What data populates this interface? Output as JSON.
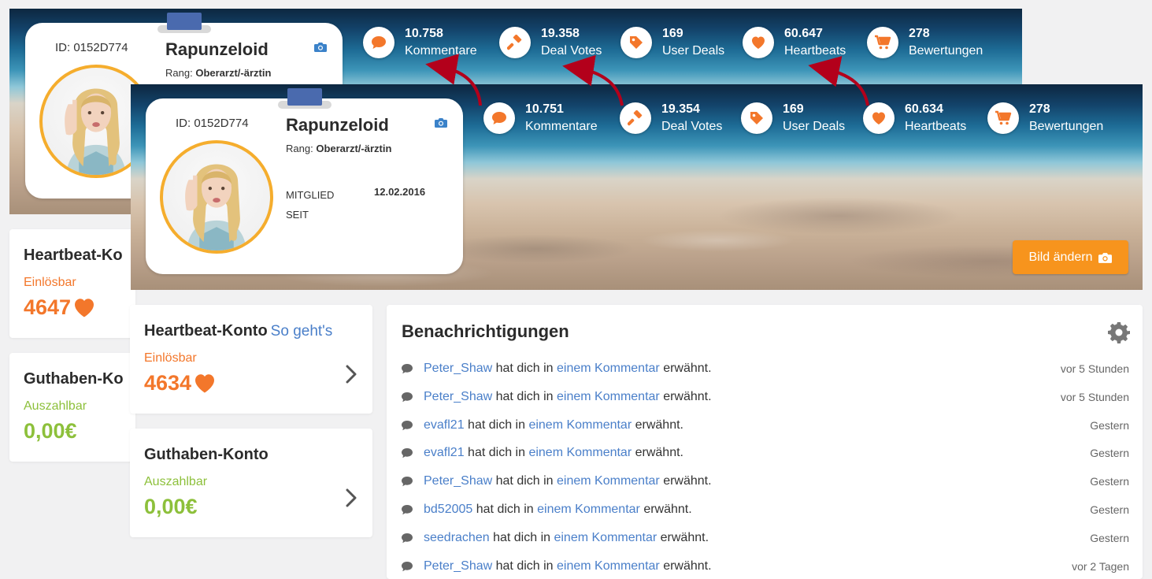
{
  "before": {
    "profile": {
      "id": "ID: 0152D774",
      "name": "Rapunzeloid",
      "rank_label": "Rang:",
      "rank_value": "Oberarzt/-ärztin"
    },
    "stats": [
      {
        "icon": "comment-icon",
        "value": "10.758",
        "label": "Kommentare"
      },
      {
        "icon": "hammer-icon",
        "value": "19.358",
        "label": "Deal Votes"
      },
      {
        "icon": "tag-icon",
        "value": "169",
        "label": "User Deals"
      },
      {
        "icon": "heart-icon",
        "value": "60.647",
        "label": "Heartbeats"
      },
      {
        "icon": "cart-icon",
        "value": "278",
        "label": "Bewertungen"
      }
    ],
    "heartbeat": {
      "title": "Heartbeat-Ko",
      "sub": "Einlösbar",
      "value": "4647"
    },
    "guthaben": {
      "title": "Guthaben-Ko",
      "sub": "Auszahlbar",
      "value": "0,00€"
    }
  },
  "after": {
    "profile": {
      "id": "ID: 0152D774",
      "name": "Rapunzeloid",
      "rank_label": "Rang:",
      "rank_value": "Oberarzt/-ärztin",
      "member_label_1": "MITGLIED",
      "member_label_2": "SEIT",
      "member_date": "12.02.2016"
    },
    "stats": [
      {
        "icon": "comment-icon",
        "value": "10.751",
        "label": "Kommentare"
      },
      {
        "icon": "hammer-icon",
        "value": "19.354",
        "label": "Deal Votes"
      },
      {
        "icon": "tag-icon",
        "value": "169",
        "label": "User Deals"
      },
      {
        "icon": "heart-icon",
        "value": "60.634",
        "label": "Heartbeats"
      },
      {
        "icon": "cart-icon",
        "value": "278",
        "label": "Bewertungen"
      }
    ],
    "change_image_label": "Bild ändern",
    "heartbeat": {
      "title": "Heartbeat-Konto",
      "link": "So geht's",
      "sub": "Einlösbar",
      "value": "4634"
    },
    "guthaben": {
      "title": "Guthaben-Konto",
      "sub": "Auszahlbar",
      "value": "0,00€"
    },
    "notifications": {
      "title": "Benachrichtigungen",
      "items": [
        {
          "user": "Peter_Shaw",
          "mid": "hat dich in",
          "link": "einem Kommentar",
          "end": "erwähnt.",
          "time": "vor 5 Stunden"
        },
        {
          "user": "Peter_Shaw",
          "mid": "hat dich in",
          "link": "einem Kommentar",
          "end": "erwähnt.",
          "time": "vor 5 Stunden"
        },
        {
          "user": "evafl21",
          "mid": "hat dich in",
          "link": "einem Kommentar",
          "end": "erwähnt.",
          "time": "Gestern"
        },
        {
          "user": "evafl21",
          "mid": "hat dich in",
          "link": "einem Kommentar",
          "end": "erwähnt.",
          "time": "Gestern"
        },
        {
          "user": "Peter_Shaw",
          "mid": "hat dich in",
          "link": "einem Kommentar",
          "end": "erwähnt.",
          "time": "Gestern"
        },
        {
          "user": "bd52005",
          "mid": "hat dich in",
          "link": "einem Kommentar",
          "end": "erwähnt.",
          "time": "Gestern"
        },
        {
          "user": "seedrachen",
          "mid": "hat dich in",
          "link": "einem Kommentar",
          "end": "erwähnt.",
          "time": "Gestern"
        },
        {
          "user": "Peter_Shaw",
          "mid": "hat dich in",
          "link": "einem Kommentar",
          "end": "erwähnt.",
          "time": "vor 2 Tagen"
        }
      ]
    }
  },
  "colors": {
    "accent_orange": "#f3772b",
    "button_orange": "#f7941d",
    "green": "#8dc03b",
    "link_blue": "#4a7fc9",
    "avatar_ring": "#f5ad2d",
    "arrow_red": "#b3001b"
  }
}
